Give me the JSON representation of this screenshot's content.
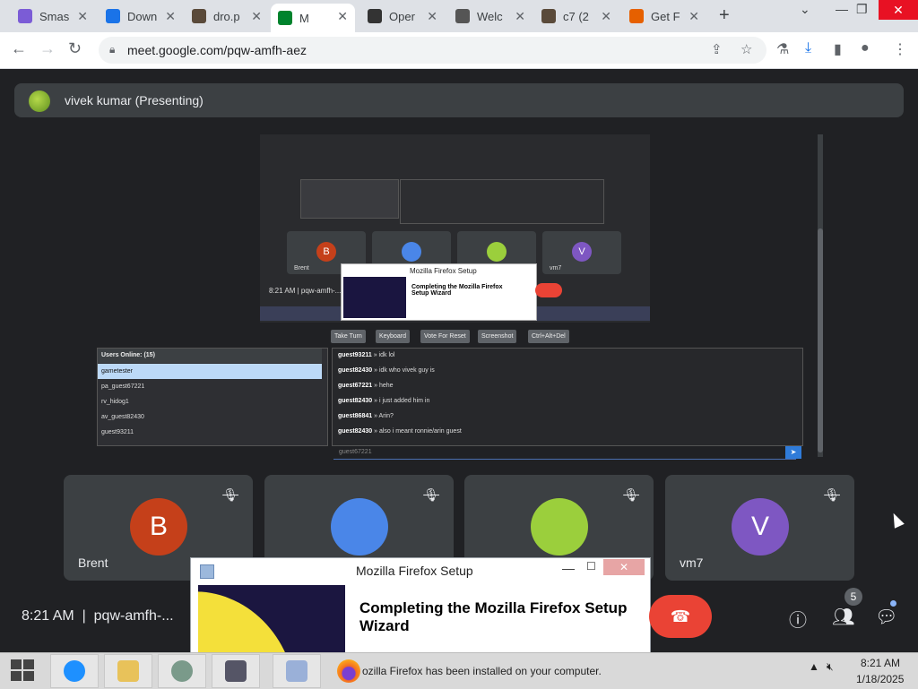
{
  "browser": {
    "tabs": [
      {
        "label": "Smas",
        "color": "#7b5cd6"
      },
      {
        "label": "Down",
        "color": "#1a73e8"
      },
      {
        "label": "dro.p",
        "color": "#5a4a3a"
      },
      {
        "label": "M",
        "color": "#00832d"
      },
      {
        "label": "Oper",
        "color": "#333333"
      },
      {
        "label": "Welc",
        "color": "#555555"
      },
      {
        "label": "c7 (2",
        "color": "#5a4a3a"
      },
      {
        "label": "Get F",
        "color": "#e66000"
      }
    ],
    "url": "meet.google.com/pqw-amfh-aez"
  },
  "meet": {
    "presenter": "vivek kumar (Presenting)",
    "time": "8:21 AM",
    "meeting_code": "pqw-amfh-...",
    "participant_count": "5",
    "participants": [
      {
        "initial": "B",
        "name": "Brent",
        "color": "#c5401a"
      },
      {
        "initial": "",
        "name": "",
        "color": "#4a86e8"
      },
      {
        "initial": "",
        "name": "",
        "color": "#9bcf3c"
      },
      {
        "initial": "V",
        "name": "vm7",
        "color": "#7e57c2"
      }
    ]
  },
  "shared_screen": {
    "mini_tiles": [
      {
        "initial": "B",
        "name": "Brent",
        "color": "#c5401a"
      },
      {
        "initial": "",
        "name": "",
        "color": "#4a86e8"
      },
      {
        "initial": "",
        "name": "",
        "color": "#9bcf3c"
      },
      {
        "initial": "V",
        "name": "vm7",
        "color": "#7e57c2"
      }
    ],
    "mini_time": "8:21 AM",
    "mini_code": "pqw-amfh-...",
    "mini_window_title": "Mozilla Firefox Setup",
    "mini_window_heading": "Completing the Mozilla Firefox Setup Wizard",
    "buttons": [
      "Take Turn",
      "Keyboard",
      "Vote For Reset",
      "Screenshot",
      "Ctrl+Alt+Del"
    ],
    "users_header": "Users Online: (15)",
    "users": [
      "gametester",
      "pa_guest67221",
      "rv_hidog1",
      "av_guest82430",
      "guest93211"
    ],
    "chat": [
      {
        "user": "guest93211",
        "msg": "idk lol"
      },
      {
        "user": "guest82430",
        "msg": "idk who vivek guy is"
      },
      {
        "user": "guest67221",
        "msg": "hehe"
      },
      {
        "user": "guest82430",
        "msg": "i just added him in"
      },
      {
        "user": "guest86841",
        "msg": "Arin?"
      },
      {
        "user": "guest82430",
        "msg": "also i meant ronnie/arin guest"
      }
    ],
    "chat_input_name": "guest67221"
  },
  "setup_window": {
    "title": "Mozilla Firefox Setup",
    "heading": "Completing the Mozilla Firefox Setup Wizard"
  },
  "taskbar": {
    "firefox_text": "ozilla Firefox has been installed on your computer.",
    "clock_time": "8:21 AM",
    "clock_date": "1/18/2025"
  }
}
